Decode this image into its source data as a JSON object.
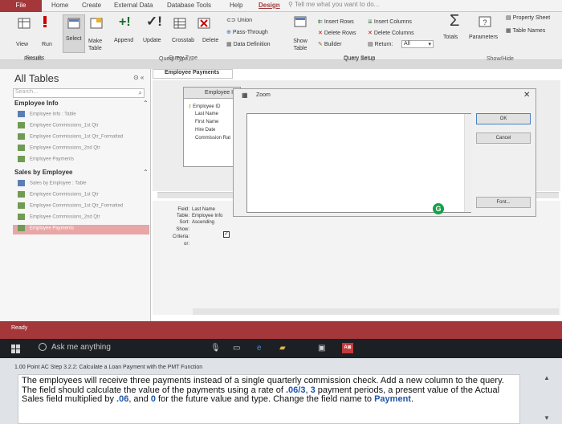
{
  "tabs": [
    "File",
    "Home",
    "Create",
    "External Data",
    "Database Tools",
    "Help",
    "Design"
  ],
  "tell_me": "Tell me what you want to do...",
  "ribbon": {
    "results": {
      "view": "View",
      "run": "Run",
      "group": "Results"
    },
    "query_type": {
      "select": "Select",
      "make_table": "Make Table",
      "append": "Append",
      "update": "Update",
      "crosstab": "Crosstab",
      "delete": "Delete",
      "union": "Union",
      "pass_through": "Pass-Through",
      "data_definition": "Data Definition",
      "group": "Query Type"
    },
    "query_setup": {
      "show_table": "Show Table",
      "insert_rows": "Insert Rows",
      "delete_rows": "Delete Rows",
      "builder": "Builder",
      "insert_columns": "Insert Columns",
      "delete_columns": "Delete Columns",
      "return_label": "Return:",
      "return_value": "All",
      "group": "Query Setup"
    },
    "show_hide": {
      "totals": "Totals",
      "parameters": "Parameters",
      "property_sheet": "Property Sheet",
      "table_names": "Table Names",
      "group": "Show/Hide"
    }
  },
  "nav": {
    "title": "All Tables",
    "search_placeholder": "Search...",
    "groups": [
      {
        "name": "Employee Info",
        "items": [
          "Employee Info : Table",
          "Employee Commissions_1st Qtr",
          "Employee Commissions_1st Qtr_Formatted",
          "Employee Commissions_2nd Qtr",
          "Employee Payments"
        ]
      },
      {
        "name": "Sales by Employee",
        "items": [
          "Sales by Employee : Table",
          "Employee Commissions_1st Qtr",
          "Employee Commissions_1st Qtr_Formatted",
          "Employee Commissions_2nd Qtr",
          "Employee Payments"
        ]
      }
    ]
  },
  "document": {
    "tab_title": "Employee Payments",
    "table_box": {
      "title": "Employee Info",
      "fields": [
        "Employee ID",
        "Last Name",
        "First Name",
        "Hire Date",
        "Commission Rat"
      ]
    },
    "grid": {
      "row_labels": [
        "Field:",
        "Table:",
        "Sort:",
        "Show:",
        "Criteria:",
        "or:"
      ],
      "field": "Last Name",
      "table": "Employee Info",
      "sort": "Ascending",
      "show_checked": "✓"
    }
  },
  "zoom": {
    "title": "Zoom",
    "ok": "OK",
    "cancel": "Cancel",
    "font": "Font..."
  },
  "status": "Ready",
  "taskbar": {
    "ask": "Ask me anything",
    "app_badge": "A≣"
  },
  "question": {
    "header": "1.00 Point AC Step 3.2.2: Calculate a Loan Payment with the PMT Function",
    "text_parts": [
      "The employees will receive three payments instead of a single quarterly commission check. Add a new column to the query. The field should calculate the value of the payments using a rate of ",
      ".06/3",
      ", ",
      "3",
      " payment periods, a present value of the Actual Sales field multiplied by ",
      ".06",
      ", and ",
      "0",
      " for the future value and type. Change the field name to ",
      "Payment",
      "."
    ]
  },
  "colors": {
    "access_red": "#a4373a",
    "taskbar": "#1c1f24",
    "highlight_blue": "#1f56a8"
  }
}
